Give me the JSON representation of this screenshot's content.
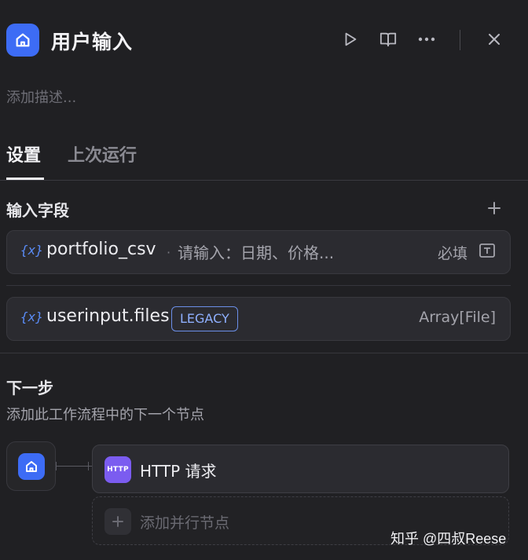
{
  "header": {
    "title": "用户输入",
    "description_placeholder": "添加描述...",
    "actions": [
      "play-icon",
      "book-icon",
      "more-icon",
      "close-icon"
    ]
  },
  "tabs": [
    {
      "label": "设置",
      "active": true
    },
    {
      "label": "上次运行",
      "active": false
    }
  ],
  "input_fields": {
    "title": "输入字段",
    "items": [
      {
        "var_icon": "{x}",
        "name": "portfolio_csv",
        "separator": "·",
        "hint": "请输入：日期、价格...",
        "required_label": "必填",
        "type_icon": "text-field-icon"
      },
      {
        "var_icon": "{x}",
        "name": "userinput.files",
        "badge": "LEGACY",
        "type_label": "Array[File]"
      }
    ]
  },
  "next_step": {
    "title": "下一步",
    "description": "添加此工作流程中的下一个节点",
    "next_node": {
      "icon_text": "HTTP",
      "label": "HTTP 请求"
    },
    "add_parallel_label": "添加并行节点"
  },
  "watermark": "知乎 @四叔Reese",
  "colors": {
    "background": "#202023",
    "accent_blue": "#3d6cf5",
    "http_purple": "#7b5cf0",
    "legacy_badge": "#8fb0ff"
  }
}
